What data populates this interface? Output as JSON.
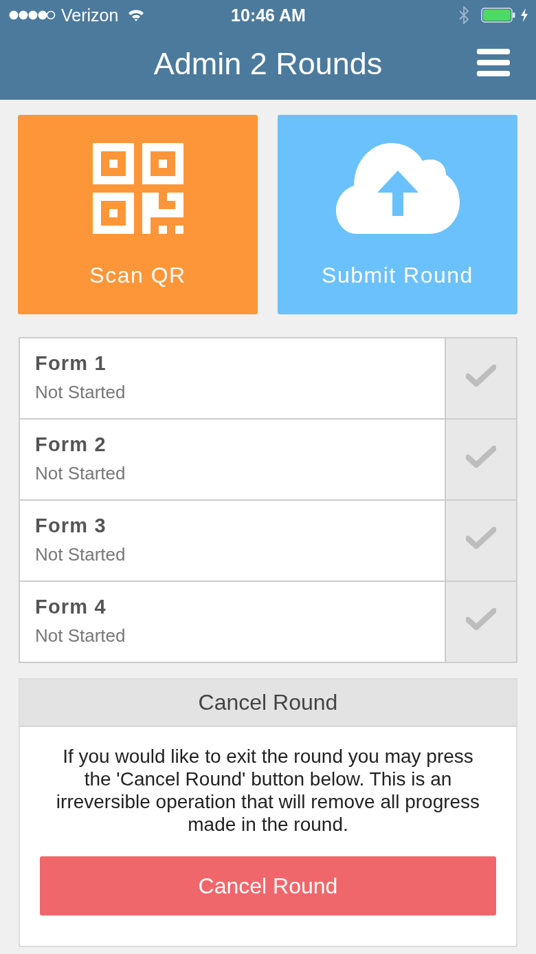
{
  "status_bar": {
    "carrier": "Verizon",
    "time": "10:46 AM"
  },
  "header": {
    "title": "Admin 2 Rounds"
  },
  "actions": [
    {
      "kind": "scan",
      "label": "Scan QR"
    },
    {
      "kind": "submit",
      "label": "Submit Round"
    }
  ],
  "forms": [
    {
      "name": "Form 1",
      "status": "Not Started"
    },
    {
      "name": "Form 2",
      "status": "Not Started"
    },
    {
      "name": "Form 3",
      "status": "Not Started"
    },
    {
      "name": "Form 4",
      "status": "Not Started"
    }
  ],
  "cancel_panel": {
    "title": "Cancel Round",
    "message": "If you would like to exit the round you may press the 'Cancel Round' button below. This is an irreversible operation that will remove all progress made in the round.",
    "button": "Cancel Round"
  }
}
